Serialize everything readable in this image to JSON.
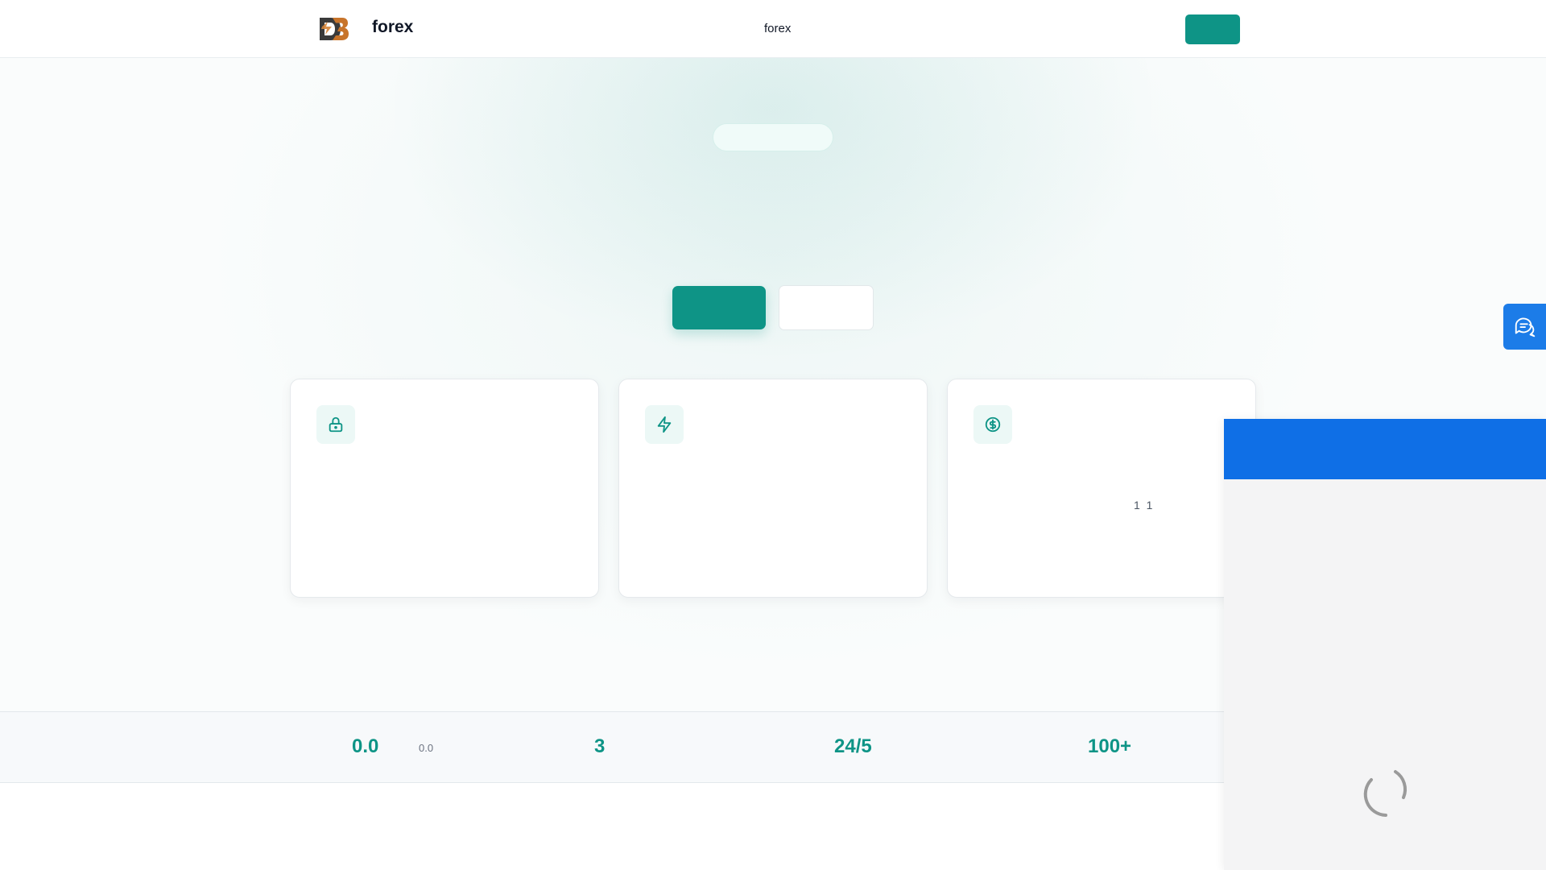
{
  "header": {
    "brand": "forex",
    "nav_link": "forex",
    "action_label": ""
  },
  "hero": {
    "pill_label": "",
    "primary_cta_label": "",
    "secondary_cta_label": ""
  },
  "features": [
    {
      "icon": "lock-icon",
      "note": ""
    },
    {
      "icon": "lightning-icon",
      "note": ""
    },
    {
      "icon": "dollar-icon",
      "note": "1 1"
    }
  ],
  "stats": [
    {
      "value": "0.0",
      "sub": "0.0"
    },
    {
      "value": "3"
    },
    {
      "value": "24/5"
    },
    {
      "value": "100+"
    }
  ],
  "colors": {
    "accent": "#0e9486",
    "chat_blue": "#0f6fe6",
    "chat_launcher": "#1c7ce8"
  }
}
